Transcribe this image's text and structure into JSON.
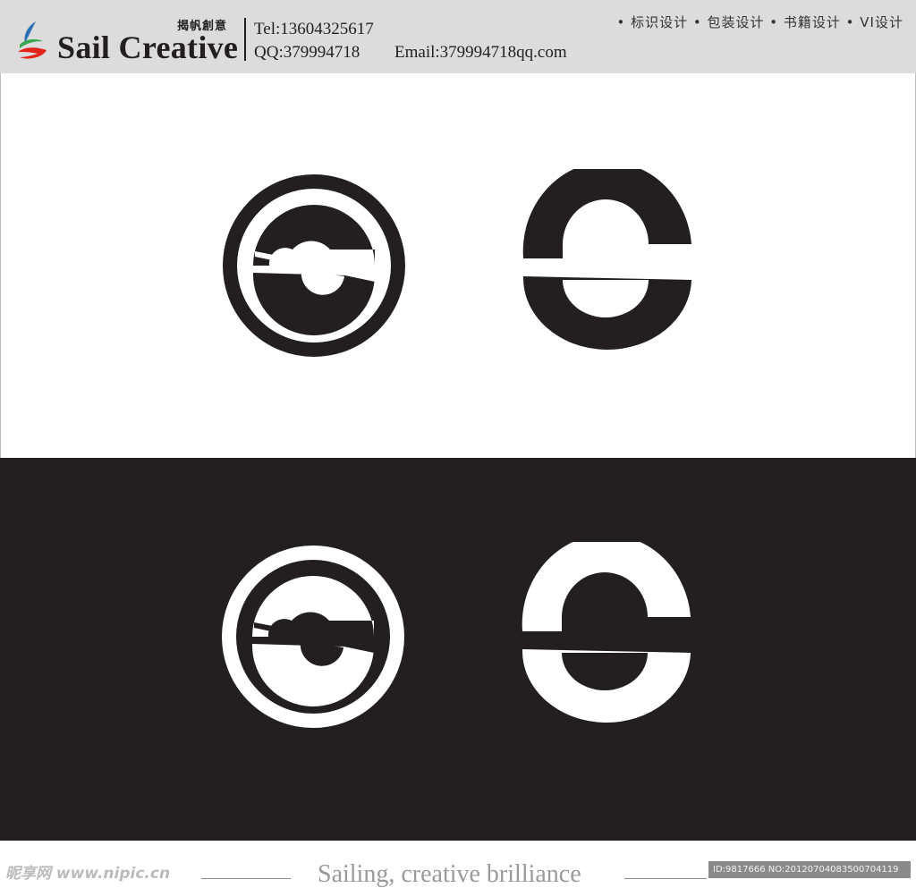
{
  "header": {
    "brand_cn": "揭帆創意",
    "brand_name": "Sail Creative",
    "tel": "Tel:13604325617",
    "qq": "QQ:379994718",
    "email": "Email:379994718qq.com",
    "services": "• 标识设计 • 包装设计 • 书籍设计 • VI设计"
  },
  "colors": {
    "ink": "#231f20",
    "paper": "#ffffff",
    "header_bg": "#dcdcdc",
    "mark_blue": "#2b6fb5",
    "mark_green": "#3aa650",
    "mark_red": "#e2231a"
  },
  "icons": {
    "brand_mark": "sail-mark-icon",
    "logo_variants": [
      "circle-s-logo-icon",
      "s-logo-icon"
    ]
  },
  "footer": {
    "watermark": "昵享网 www.nipic.cn",
    "tagline": "Sailing, creative brilliance",
    "image_id": "ID:9817666 NO:20120704083500704119"
  }
}
